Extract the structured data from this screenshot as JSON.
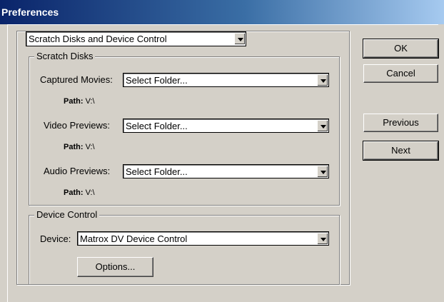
{
  "window": {
    "title": "Preferences"
  },
  "category": {
    "selected": "Scratch Disks and Device Control"
  },
  "scratch_disks": {
    "legend": "Scratch Disks",
    "rows": [
      {
        "label": "Captured Movies:",
        "value": "Select Folder...",
        "path_label": "Path:",
        "path_value": "V:\\"
      },
      {
        "label": "Video Previews:",
        "value": "Select Folder...",
        "path_label": "Path:",
        "path_value": "V:\\"
      },
      {
        "label": "Audio Previews:",
        "value": "Select Folder...",
        "path_label": "Path:",
        "path_value": "V:\\"
      }
    ]
  },
  "device_control": {
    "legend": "Device Control",
    "device_label": "Device:",
    "device_value": "Matrox DV Device Control",
    "options_label": "Options..."
  },
  "buttons": {
    "ok": "OK",
    "cancel": "Cancel",
    "previous": "Previous",
    "next": "Next"
  }
}
